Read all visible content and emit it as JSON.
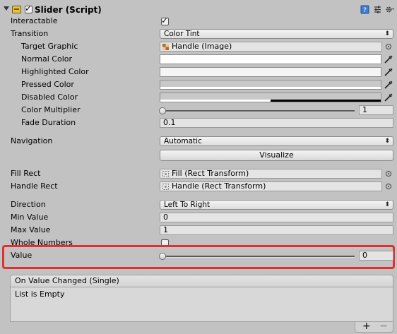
{
  "component": {
    "title": "Slider (Script)",
    "enabled": true
  },
  "properties": {
    "interactable": {
      "label": "Interactable",
      "checked": true
    },
    "transition": {
      "label": "Transition",
      "value": "Color Tint"
    },
    "target_graphic": {
      "label": "Target Graphic",
      "value": "Handle (Image)"
    },
    "normal_color": {
      "label": "Normal Color",
      "color": "#ffffff"
    },
    "highlighted_color": {
      "label": "Highlighted Color",
      "color": "#f5f5f5"
    },
    "pressed_color": {
      "label": "Pressed Color",
      "color": "#c8c8c8"
    },
    "disabled_color": {
      "label": "Disabled Color",
      "color": "#c8c8c8"
    },
    "color_multiplier": {
      "label": "Color Multiplier",
      "value": "1",
      "fraction": 0.0
    },
    "fade_duration": {
      "label": "Fade Duration",
      "value": "0.1"
    },
    "navigation": {
      "label": "Navigation",
      "value": "Automatic"
    },
    "visualize_button": "Visualize",
    "fill_rect": {
      "label": "Fill Rect",
      "value": "Fill (Rect Transform)"
    },
    "handle_rect": {
      "label": "Handle Rect",
      "value": "Handle (Rect Transform)"
    },
    "direction": {
      "label": "Direction",
      "value": "Left To Right"
    },
    "min_value": {
      "label": "Min Value",
      "value": "0"
    },
    "max_value": {
      "label": "Max Value",
      "value": "1"
    },
    "whole_numbers": {
      "label": "Whole Numbers",
      "checked": false
    },
    "value": {
      "label": "Value",
      "value": "0",
      "fraction": 0.0
    }
  },
  "event": {
    "header": "On Value Changed (Single)",
    "empty_text": "List is Empty",
    "add_label": "+",
    "remove_label": "−"
  },
  "colors": {
    "highlight_border": "#e03030",
    "panel_bg": "#c2c2c2"
  }
}
